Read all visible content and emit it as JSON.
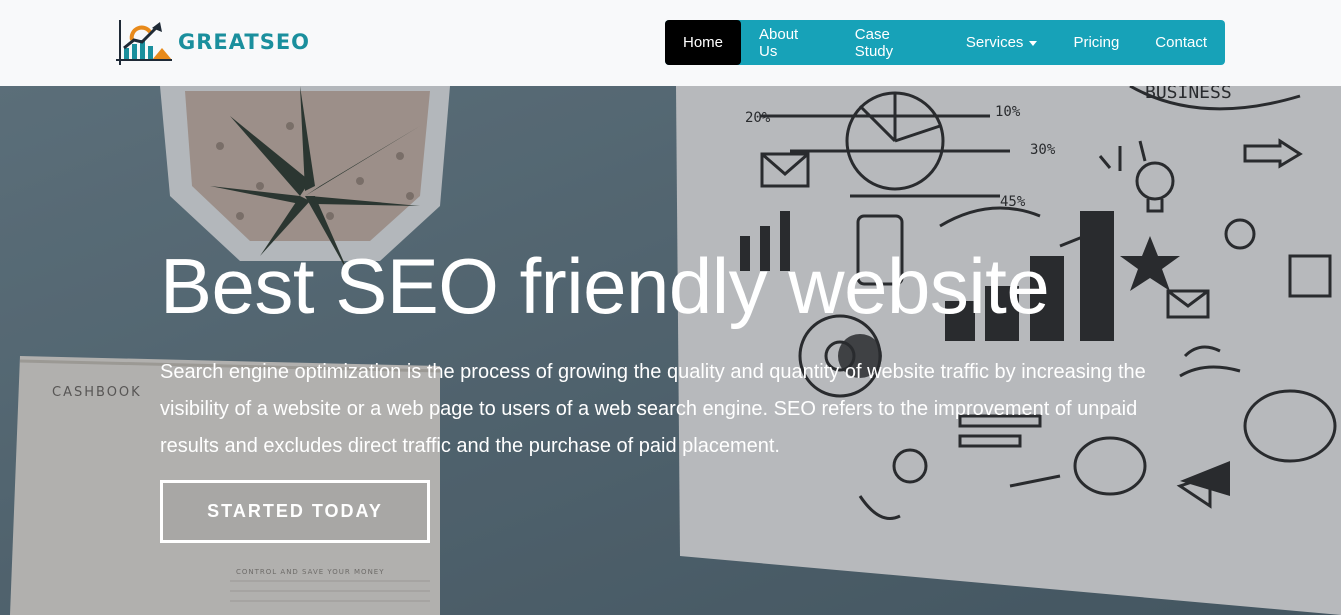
{
  "brand": {
    "name": "GREATSEO",
    "colors": {
      "teal": "#1a8f9d",
      "orange": "#e88a1a",
      "dark": "#1f2a36"
    }
  },
  "nav": {
    "items": [
      {
        "label": "Home",
        "active": true
      },
      {
        "label": "About Us",
        "active": false
      },
      {
        "label": "Case Study",
        "active": false
      },
      {
        "label": "Services",
        "active": false,
        "dropdown": true
      },
      {
        "label": "Pricing",
        "active": false
      },
      {
        "label": "Contact",
        "active": false
      }
    ],
    "colors": {
      "bar": "#17a2b8",
      "active": "#000000",
      "text": "#ffffff"
    }
  },
  "hero": {
    "headline": "Best SEO friendly website",
    "paragraph": "Search engine optimization is the process of growing the quality and quantity of website traffic by increasing the visibility of a website or a web page to users of a web search engine. SEO refers to the improvement of unpaid results and excludes direct traffic and the purchase of paid placement.",
    "cta_label": "STARTED TODAY",
    "background_photo_text": {
      "cashbook": "CASHBOOK",
      "cashbook_footer": "CONTROL AND SAVE YOUR MONEY",
      "sketch_labels": [
        "20%",
        "10%",
        "30%",
        "45%",
        "BUSINESS"
      ]
    }
  }
}
